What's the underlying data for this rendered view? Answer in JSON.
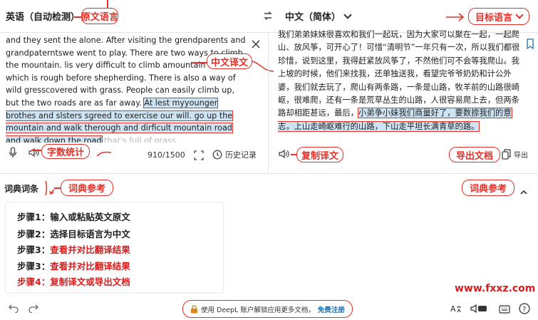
{
  "topbar": {
    "source_lang": "英语（自动检测）",
    "target_lang": "中文（简体）",
    "swap_icon": "swap-arrows-icon"
  },
  "annotations": {
    "source_lang_tag": "原文语言",
    "target_lang_tag": "目标语言",
    "translation_tag": "中文译文",
    "char_count_tag": "字数统计",
    "dict_ref_left_tag": "词典参考",
    "dict_ref_right_tag": "词典参考",
    "copy_tag": "复制译文",
    "export_tag": "导出文档"
  },
  "source": {
    "text_before": "and they sent the alone. After visiting the grendparents and grandpaterntswe went to play. There are two ways to climb the mountain. lis very difficult to climb amountain road which is rough before shepherding. There is also a way of wild gresscovered with grass. People can easily climb up, but the two roads are as far away. ",
    "text_highlight": "At lest myyounger brothes and slsters sgreed to exercise our will. go up the mountain and walk therough and dirficult mountain road and walk down the road",
    "text_faded": " that's full of grass.",
    "char_count": "910/1500",
    "history_label": "历史记录"
  },
  "target": {
    "text_before": "我们弟弟妹妹很喜欢和我们一起玩，因为大家可以聚在一起，一起爬山、放风筝，可开心了！可惜“清明节”一年只有一次，所以我们都很珍惜，说到这里，我得赶紧放风筝了，不然他们可不会等我爬山。我上坡的时候，他们来找我，还单独送我，看望完爷爷奶奶和计公外婆，我们就去玩了，爬山有两条路，一条是山路，牧羊前的山路很崎岖，很难爬，还有一条是荒草丛生的山路，人很容易爬上去，但两条路却相距甚远，最后，",
    "text_highlight": "小弟争小妹我们商量好了，要数捺我们的意志，上山走崎岖难行的山路，下山走平坦长满青草的路。",
    "export_label": "导出"
  },
  "dictionary": {
    "title": "词典词条",
    "steps": [
      {
        "prefix": "步骤1：",
        "text": "输入或粘贴英文原文",
        "color": "#1f1f1f"
      },
      {
        "prefix": "步骤2：",
        "text": "选择目标语言为中文",
        "color": "#1f1f1f"
      },
      {
        "prefix": "步骤3：",
        "text": "查看并对比翻译结果",
        "color": "#d41e1e"
      },
      {
        "prefix": "步骤3：",
        "text": "查看并对比翻译结果",
        "color": "#d41e1e"
      },
      {
        "prefix": "步骤4：",
        "text": "复制译文或导出文档",
        "color": "#d41e1e"
      }
    ]
  },
  "bottom": {
    "promo_text": "使用 DeepL 账户解锁应用更多文档，",
    "promo_link": "免费注册",
    "watermark": "www.fxxz.com"
  },
  "colors": {
    "accent_red": "#e0322b",
    "highlight_blue": "#cfe4f3"
  }
}
